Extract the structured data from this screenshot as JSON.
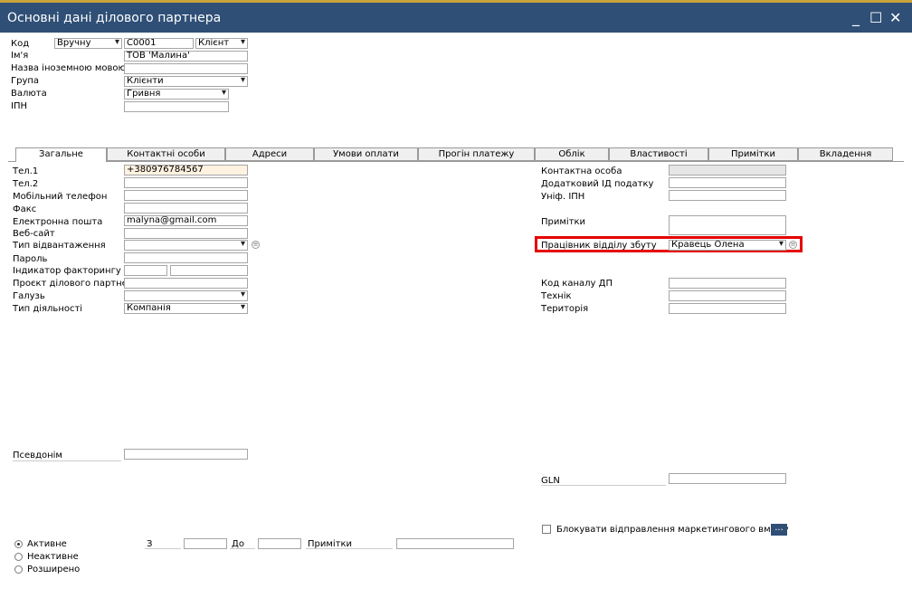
{
  "window": {
    "title": "Основні дані ділового партнера",
    "minimize": "_",
    "maximize": "☐",
    "close": "✕"
  },
  "header": {
    "code_label": "Код",
    "code_mode": "Вручну",
    "code_value": "C0001",
    "type_value": "Клієнт",
    "name_label": "Ім'я",
    "name_value": "ТОВ 'Малина'",
    "foreign_name_label": "Назва іноземною мовою",
    "foreign_name_value": "",
    "group_label": "Група",
    "group_value": "Клієнти",
    "currency_label": "Валюта",
    "currency_value": "Гривня",
    "tax_id_label": "ІПН",
    "tax_id_value": ""
  },
  "tabs": [
    "Загальне",
    "Контактні особи",
    "Адреси",
    "Умови оплати",
    "Прогін платежу",
    "Облік",
    "Властивості",
    "Примітки",
    "Вкладення"
  ],
  "left": {
    "tel1_label": "Тел.1",
    "tel1_value": "+380976784567",
    "tel2_label": "Тел.2",
    "mobile_label": "Мобільний телефон",
    "fax_label": "Факс",
    "email_label": "Електронна пошта",
    "email_value": "malyna@gmail.com",
    "web_label": "Веб-сайт",
    "shipping_label": "Тип відвантаження",
    "password_label": "Пароль",
    "factoring_label": "Індикатор факторингу",
    "project_label": "Проєкт ділового партнера",
    "industry_label": "Галузь",
    "business_type_label": "Тип діяльності",
    "business_type_value": "Компанія",
    "alias_label": "Псевдонім"
  },
  "right": {
    "contact_label": "Контактна особа",
    "addl_tax_label": "Додатковий ІД податку",
    "unif_tax_label": "Уніф. ІПН",
    "remarks_label": "Примітки",
    "sales_employee_label": "Працівник відділу збуту",
    "sales_employee_value": "Кравець Олена",
    "channel_code_label": "Код каналу ДП",
    "technician_label": "Технік",
    "territory_label": "Територія",
    "gln_label": "GLN",
    "block_marketing_label": "Блокувати відправлення маркетингового вмісту",
    "more_button": "..."
  },
  "status": {
    "active_label": "Активне",
    "inactive_label": "Неактивне",
    "advanced_label": "Розширено",
    "from_label": "З",
    "to_label": "До",
    "remarks_label": "Примітки",
    "selected": "active"
  },
  "colors": {
    "titlebar": "#2f4f76",
    "highlight": "#e60000",
    "tel_field": "#fff2e0"
  }
}
